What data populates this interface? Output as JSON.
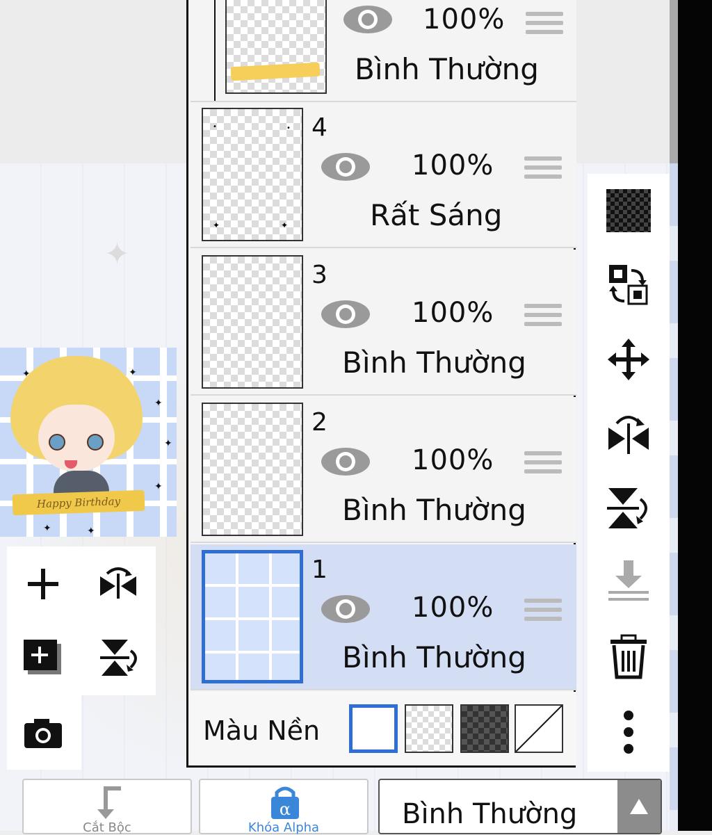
{
  "layers": [
    {
      "number": "",
      "opacity": "100%",
      "blend": "Bình Thường"
    },
    {
      "number": "4",
      "opacity": "100%",
      "blend": "Rất Sáng"
    },
    {
      "number": "3",
      "opacity": "100%",
      "blend": "Bình Thường"
    },
    {
      "number": "2",
      "opacity": "100%",
      "blend": "Bình Thường"
    },
    {
      "number": "1",
      "opacity": "100%",
      "blend": "Bình Thường",
      "selected": true
    }
  ],
  "background_color": {
    "label": "Màu Nền",
    "options": [
      "white",
      "transparent",
      "dark-checker",
      "none"
    ],
    "selected": "white"
  },
  "thumbnail": {
    "ribbon_text": "Happy Birthday"
  },
  "bottom_bar": {
    "blend_mode_value": "Bình Thường",
    "button1_label": "Cắt Bộc",
    "button2_label": "Khóa Alpha"
  },
  "colors": {
    "selection_blue": "#2f6fd3",
    "selected_row": "#d3def5",
    "accent_blue": "#3a86d8"
  }
}
